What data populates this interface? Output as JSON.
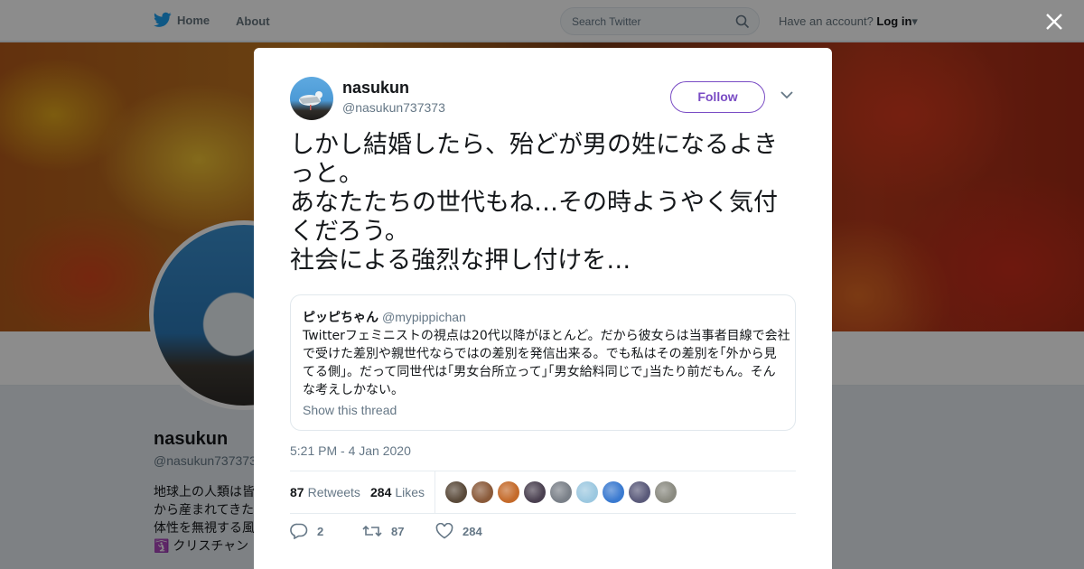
{
  "topbar": {
    "home_label": "Home",
    "about_label": "About",
    "search_placeholder": "Search Twitter",
    "account_prompt": "Have an account?",
    "login_label": "Log in"
  },
  "profile": {
    "name": "nasukun",
    "handle": "@nasukun737373",
    "bio_lines": [
      "地球上の人類は皆",
      "から産まれてきた",
      "体性を無視する風",
      "🛐 クリスチャン"
    ]
  },
  "tweet": {
    "author_name": "nasukun",
    "author_handle": "@nasukun737373",
    "follow_label": "Follow",
    "text_lines": [
      "しかし結婚したら、殆どが男の姓になるよき",
      "っと。",
      "あなたたちの世代もね…その時ようやく気付",
      "くだろう。",
      "社会による強烈な押し付けを…"
    ],
    "quote": {
      "author_name": "ピッピちゃん",
      "author_handle": "@mypippichan",
      "text_lines": [
        "Twitterフェミニストの視点は20代以降がほとんど。だから彼女らは当事者目線で会社",
        "で受けた差別や親世代ならではの差別を発信出来る。でも私はその差別を｢外から見",
        "てる側｣。だって同世代は｢男女台所立って｣｢男女給料同じで｣当たり前だもん。そん",
        "な考えしかない。"
      ],
      "show_thread_label": "Show this thread"
    },
    "timestamp": "5:21 PM - 4 Jan 2020",
    "retweets_count": "87",
    "retweets_label": "Retweets",
    "likes_count": "284",
    "likes_label": "Likes",
    "liker_avatar_colors": [
      "#5a4a3a",
      "#8a5a3a",
      "#c46a2a",
      "#4a4050",
      "#7a8088",
      "#9cc8e0",
      "#3a7ad0",
      "#5a5a7a",
      "#8a8a80"
    ],
    "reply_count": "2",
    "retweet_action_count": "87",
    "like_action_count": "284"
  },
  "colors": {
    "follow_accent": "#794bc4",
    "twitter_blue": "#1da1f2",
    "muted_text": "#657786"
  }
}
